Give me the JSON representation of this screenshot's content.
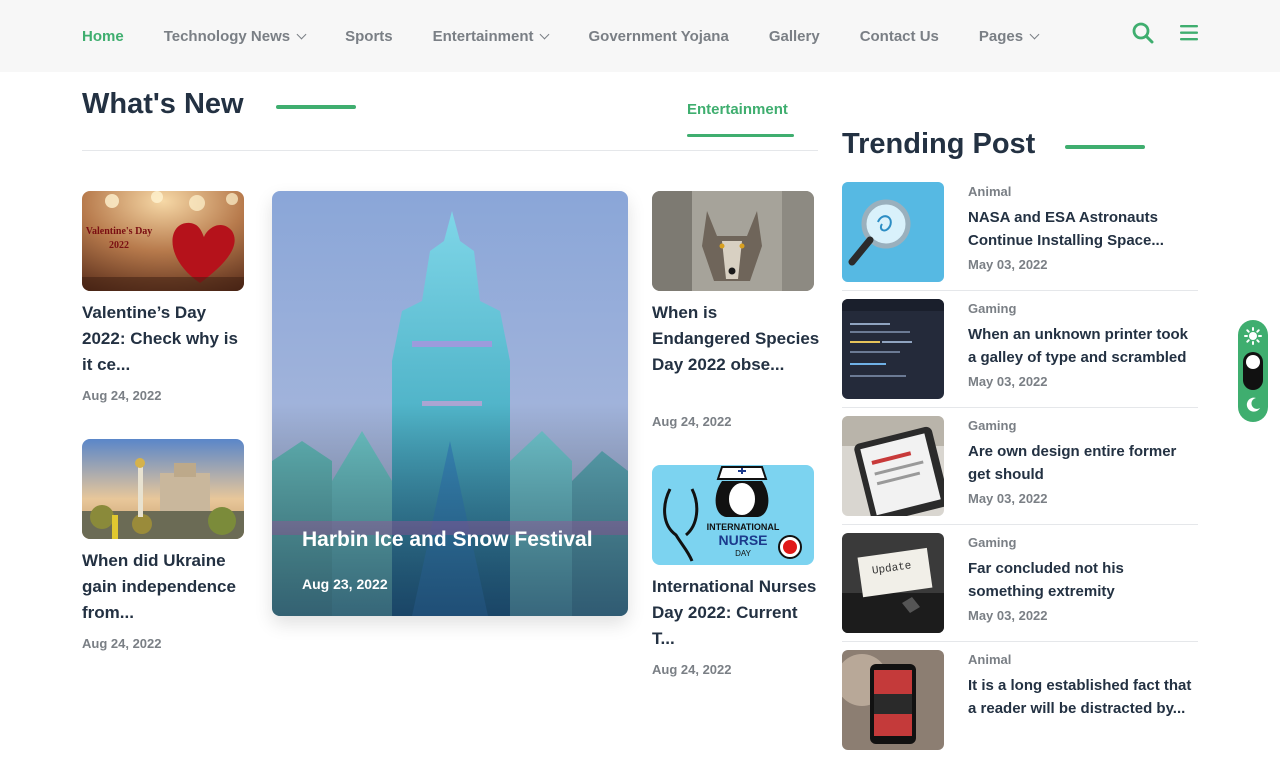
{
  "nav": {
    "items": [
      {
        "label": "Home",
        "active": true,
        "dropdown": false
      },
      {
        "label": "Technology News",
        "dropdown": true
      },
      {
        "label": "Sports",
        "dropdown": false
      },
      {
        "label": "Entertainment",
        "dropdown": true
      },
      {
        "label": "Government Yojana",
        "dropdown": false
      },
      {
        "label": "Gallery",
        "dropdown": false
      },
      {
        "label": "Contact Us",
        "dropdown": false
      },
      {
        "label": "Pages",
        "dropdown": true
      }
    ],
    "icons": [
      "search-icon",
      "menu-icon"
    ]
  },
  "whats_new": {
    "title": "What's New",
    "tab": "Entertainment",
    "cards": [
      {
        "title": "Valentine’s Day 2022: Check why is it ce...",
        "date": "Aug 24, 2022",
        "image_text": "Valentine's Day 2022"
      },
      {
        "title": "When did Ukraine gain independence from...",
        "date": "Aug 24, 2022"
      },
      {
        "title": "When is Endangered Species Day 2022 obse...",
        "date": "Aug 24, 2022"
      },
      {
        "title": "International Nurses Day 2022: Current T...",
        "date": "Aug 24, 2022",
        "image_text": [
          "INTERNATIONAL",
          "NURSE",
          "DAY"
        ]
      }
    ],
    "feature": {
      "title": "Harbin Ice and Snow Festival",
      "date": "Aug 23, 2022"
    }
  },
  "trending": {
    "title": "Trending Post",
    "items": [
      {
        "category": "Animal",
        "title": "NASA and ESA Astronauts Continue Installing Space...",
        "date": "May 03, 2022"
      },
      {
        "category": "Gaming",
        "title": "When an unknown printer took a galley of type and scrambled",
        "date": "May 03, 2022"
      },
      {
        "category": "Gaming",
        "title": "Are own design entire former get should",
        "date": "May 03, 2022"
      },
      {
        "category": "Gaming",
        "title": "Far concluded not his something extremity",
        "date": "May 03, 2022"
      },
      {
        "category": "Animal",
        "title": "It is a long established fact that a reader will be distracted by...",
        "date": ""
      }
    ]
  },
  "theme_switcher": {
    "icons": [
      "sun-icon",
      "moon-icon"
    ],
    "mode": "light"
  },
  "colors": {
    "accent": "#3fae6f",
    "heading": "#233142",
    "muted": "#7a7f85"
  }
}
